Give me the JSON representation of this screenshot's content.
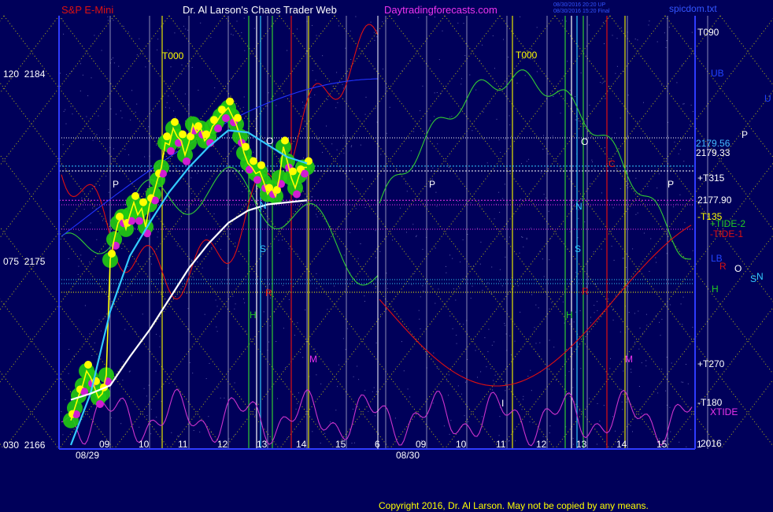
{
  "header": {
    "symbol": "S&P E-Mini",
    "title": "Dr. Al Larson's Chaos Trader Web",
    "site": "Daytradingforecasts.com",
    "timestamp_1": "08/30/2016 20:20 UP",
    "timestamp_2": "08/30/2016 15:20 Final",
    "file": "spicdom.txt"
  },
  "copyright": "Copyright 2016, Dr. Al Larson. May not be copied by any means.",
  "colors": {
    "background": "#00005a",
    "axis": "#2f3cff",
    "grid_yellow": "#e6e600",
    "price_yellow": "#ffff00",
    "bead_green": "#22cc11",
    "bead_magenta": "#d21dd2",
    "cyan": "#33ccff",
    "white": "#ffffff",
    "red": "#e01010",
    "green": "#33cc33",
    "magenta": "#cc33cc",
    "blue": "#2233ff"
  },
  "chart_data": {
    "type": "line",
    "x_axis": {
      "days": [
        "08/29",
        "08/30"
      ],
      "hour_ticks_day1": [
        "09",
        "10",
        "11",
        "12",
        "13",
        "14",
        "15",
        "6"
      ],
      "hour_ticks_day2": [
        "09",
        "10",
        "11",
        "12",
        "13",
        "14",
        "15",
        "1"
      ]
    },
    "y_axis": {
      "range": [
        2166,
        2186
      ],
      "ticks": [
        {
          "prefix": "120",
          "value": 2184,
          "text": "120  2184"
        },
        {
          "prefix": "075",
          "value": 2175,
          "text": "075  2175"
        },
        {
          "prefix": "030",
          "value": 2166,
          "text": "030  2166"
        }
      ]
    },
    "price_levels": [
      {
        "label": "2179.56",
        "value": 2179.56
      },
      {
        "label": "2179.33",
        "value": 2179.33
      },
      {
        "label": "2177.90",
        "value": 2177.9
      },
      {
        "label": "2016",
        "value": 2166
      }
    ],
    "right_labels": [
      "T090",
      "+T315",
      "-T135",
      "+TIDE-2",
      "-TIDE-1",
      "+T270",
      "-T180",
      "XTIDE",
      "UB",
      "LB",
      "U",
      "P",
      "R",
      "O",
      "S",
      "N",
      "H"
    ],
    "chart_annotations": [
      "T000",
      "T000",
      "P",
      "P",
      "P",
      "O",
      "O",
      "N",
      "N",
      "S",
      "S",
      "R",
      "R",
      "H",
      "H",
      "M",
      "M",
      "C",
      "I"
    ],
    "series": [
      {
        "name": "S&P E-Mini",
        "color": "#ffff00",
        "x": [
          0,
          0.1,
          0.2,
          0.3,
          0.4,
          0.5,
          0.6,
          0.7,
          0.8,
          0.9,
          1.0,
          1.1,
          1.2,
          1.3,
          1.4,
          1.5,
          1.6,
          1.7,
          1.8,
          1.9,
          2.0,
          2.1,
          2.2,
          2.3,
          2.4,
          2.5,
          2.6,
          2.7,
          2.8,
          2.9,
          3.0,
          3.1,
          3.2,
          3.3,
          3.4,
          3.5,
          3.6,
          3.7,
          3.8,
          3.9,
          4.0,
          4.1,
          4.2,
          4.3,
          4.4,
          4.5,
          4.6,
          4.7,
          4.8,
          4.9,
          5.0,
          5.1,
          5.2,
          5.3,
          5.4,
          5.5,
          5.6,
          5.7,
          5.8,
          5.9,
          6.0,
          6.1,
          6.2,
          6.3,
          6.4,
          6.5,
          6.6,
          6.7,
          6.8,
          6.9,
          7.0
        ],
        "y": [
          2167.2,
          2167.8,
          2168.4,
          2168.9,
          2169.6,
          2169.3,
          2168.8,
          2168.3,
          2168.5,
          2169.4,
          2175.0,
          2176.0,
          2176.8,
          2177.1,
          2176.5,
          2177.2,
          2177.8,
          2177.2,
          2177.5,
          2176.6,
          2177.7,
          2178.2,
          2178.9,
          2179.5,
          2180.7,
          2180.6,
          2181.4,
          2181.0,
          2180.8,
          2180.1,
          2180.7,
          2181.6,
          2181.2,
          2181.4,
          2180.8,
          2181.0,
          2181.5,
          2181.7,
          2182.0,
          2182.2,
          2182.4,
          2182.0,
          2181.6,
          2181.0,
          2180.2,
          2179.7,
          2179.5,
          2179.2,
          2179.3,
          2178.8,
          2178.2,
          2178.5,
          2178.1,
          2179.0,
          2180.5,
          2179.8,
          2179.0,
          2178.5,
          2179.1,
          2179.5,
          2179.5,
          null,
          null,
          null,
          null,
          null,
          null,
          null,
          null,
          null,
          null
        ]
      },
      {
        "name": "Cyan average",
        "color": "#33ccff",
        "x": [
          0,
          0.5,
          1.0,
          1.5,
          2.0,
          2.5,
          3.0,
          3.5,
          4.0,
          4.5,
          5.0,
          5.5,
          6.0
        ],
        "y": [
          2166.0,
          2168.5,
          2172.5,
          2175.2,
          2176.8,
          2178.3,
          2179.5,
          2180.5,
          2181.3,
          2181.2,
          2180.6,
          2180.0,
          2179.7
        ]
      },
      {
        "name": "White average",
        "color": "#ffffff",
        "x": [
          0,
          0.5,
          1.0,
          1.5,
          2.0,
          2.5,
          3.0,
          3.5,
          4.0,
          4.5,
          5.0,
          5.5,
          6.0
        ],
        "y": [
          2168.2,
          2168.5,
          2168.9,
          2170.3,
          2171.6,
          2173.1,
          2174.6,
          2175.8,
          2176.8,
          2177.4,
          2177.7,
          2177.8,
          2177.9
        ]
      }
    ],
    "grid": true,
    "legend": "none"
  }
}
